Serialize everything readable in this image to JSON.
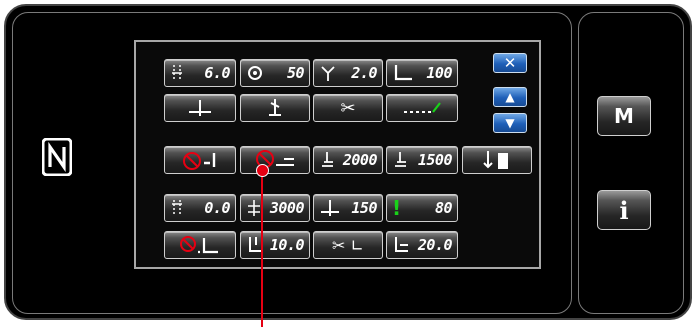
{
  "side_buttons": {
    "m_label": "M",
    "info_label": "i"
  },
  "nav": {
    "close_glyph": "✕",
    "up_glyph": "▲",
    "down_glyph": "▼"
  },
  "rows": [
    [
      {
        "name": "stitch-length",
        "icon": "stitch-length-icon",
        "value": "6.0"
      },
      {
        "name": "sewing-speed",
        "icon": "bobbin-speed-icon",
        "value": "50"
      },
      {
        "name": "needle-thread-tension",
        "icon": "thread-tension-icon",
        "value": "2.0"
      },
      {
        "name": "presser-foot-pressure",
        "icon": "presser-foot-icon",
        "value": "100"
      }
    ],
    [
      {
        "name": "needle-position",
        "icon": "needle-position-icon",
        "value": ""
      },
      {
        "name": "thread-clamp",
        "icon": "thread-clamp-icon",
        "value": ""
      },
      {
        "name": "thread-trimmer",
        "icon": "scissors-icon",
        "value": ""
      },
      {
        "name": "stitch-pattern",
        "icon": "dashed-stitch-icon",
        "value": ""
      }
    ],
    [
      {
        "name": "wiper-off-foot",
        "icon": "wiper-prohibit-icon",
        "value": ""
      },
      {
        "name": "wiper-off-presser",
        "icon": "wiper-prohibit-icon",
        "value": ""
      },
      {
        "name": "bobbin-counter-a",
        "icon": "bobbin-counter-icon",
        "value": "2000"
      },
      {
        "name": "bobbin-counter-b",
        "icon": "bobbin-counter-icon",
        "value": "1500"
      },
      {
        "name": "needle-up-down",
        "icon": "needle-up-down-icon",
        "value": ""
      }
    ],
    [
      {
        "name": "stitch-pitch",
        "icon": "stitch-length-icon",
        "value": "0.0"
      },
      {
        "name": "max-speed",
        "icon": "speed-icon",
        "value": "3000"
      },
      {
        "name": "needle-position-value",
        "icon": "needle-position-icon",
        "value": "150"
      },
      {
        "name": "warning-value",
        "icon": "exclamation-icon",
        "value": "80"
      }
    ],
    [
      {
        "name": "foot-lift-prohibit",
        "icon": "foot-lift-prohibit-icon",
        "value": ""
      },
      {
        "name": "foot-lift-height",
        "icon": "foot-lift-icon",
        "value": "10.0"
      },
      {
        "name": "trim-foot-lift",
        "icon": "scissors-foot-icon",
        "value": ""
      },
      {
        "name": "foot-lift-amount",
        "icon": "foot-lift-icon",
        "value": "20.0"
      }
    ]
  ],
  "colors": {
    "accent_red": "#e60012",
    "nav_blue": "#1f5fb8",
    "value_green": "#19d219"
  }
}
